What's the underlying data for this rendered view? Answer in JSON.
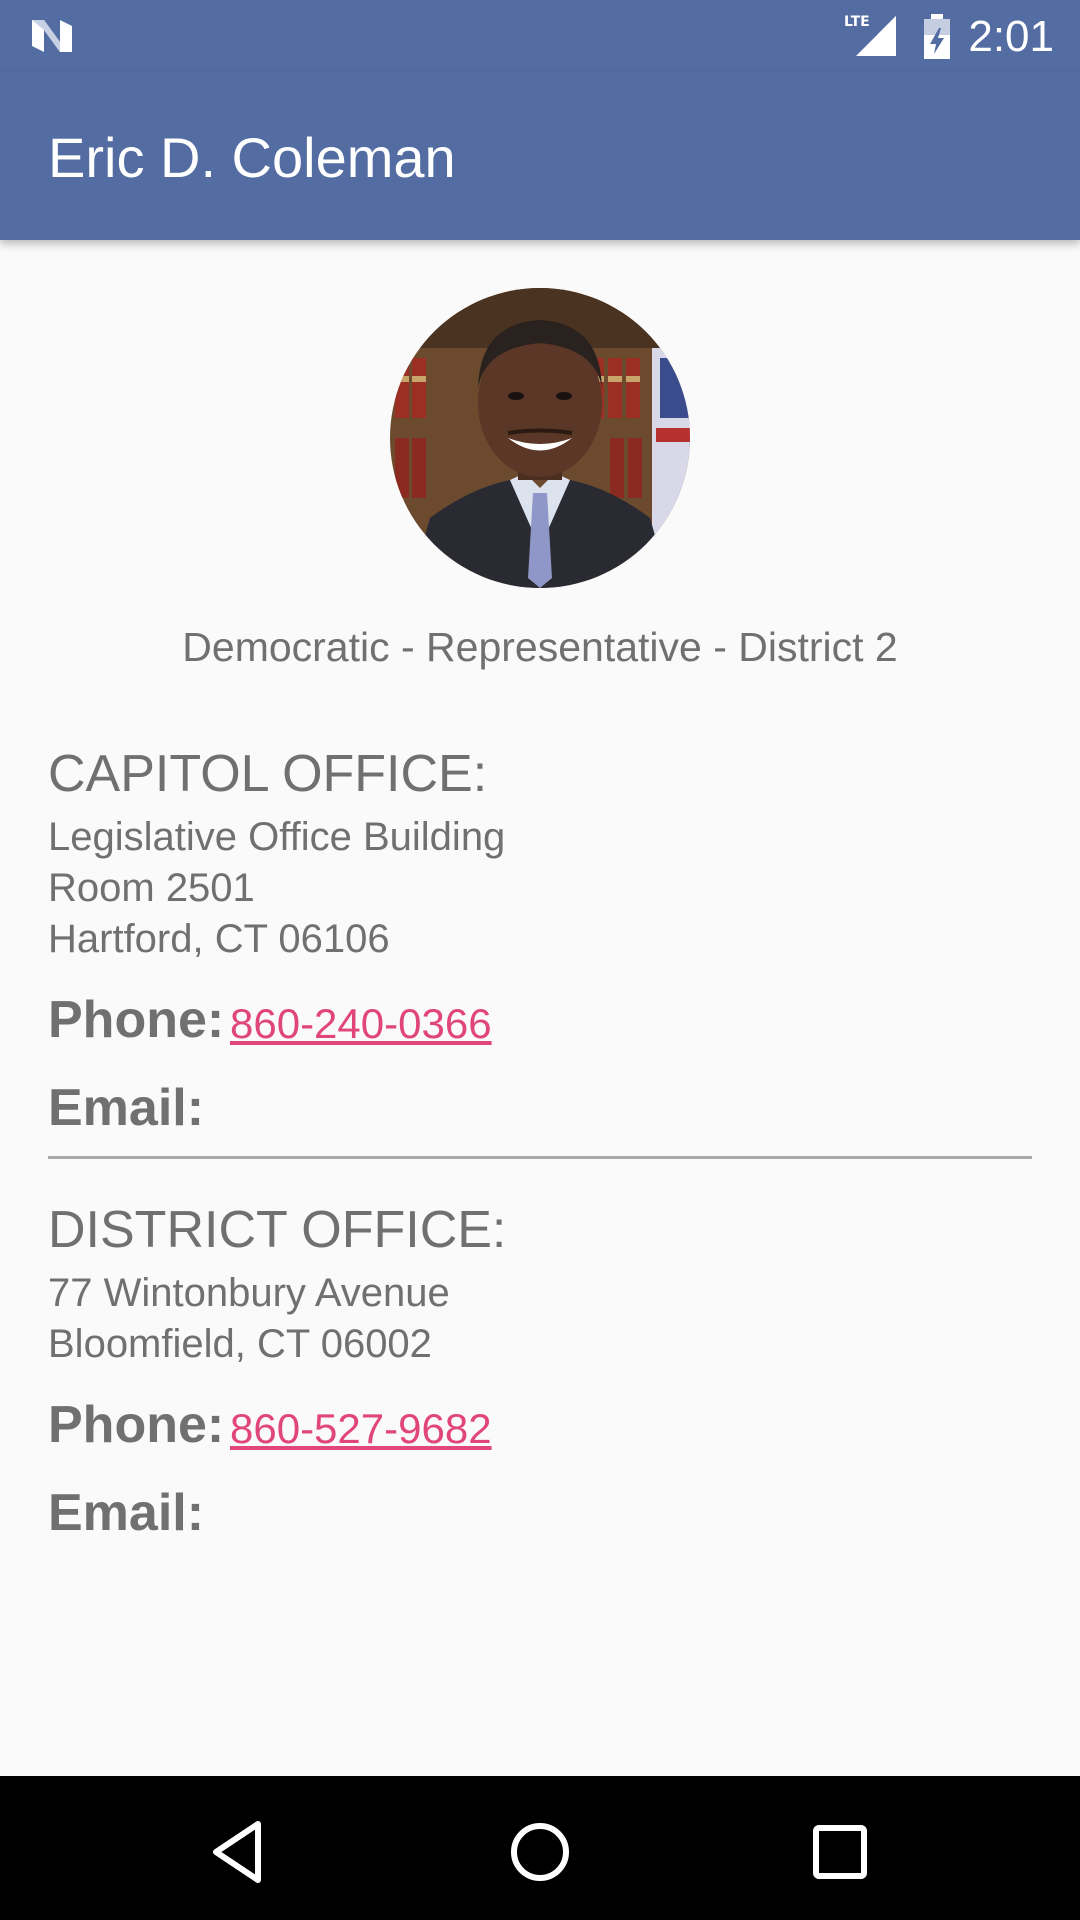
{
  "status_bar": {
    "time": "2:01",
    "network_label": "LTE",
    "icons": [
      "n-notification-icon",
      "lte-signal-icon",
      "battery-charging-icon"
    ]
  },
  "app_bar": {
    "title": "Eric D. Coleman"
  },
  "profile": {
    "subtitle": "Democratic - Representative -  District 2"
  },
  "capitol_office": {
    "heading": "CAPITOL OFFICE:",
    "address": [
      "Legislative Office Building",
      "Room 2501",
      "Hartford, CT 06106"
    ],
    "phone_label": "Phone:",
    "phone": "860-240-0366",
    "email_label": "Email:"
  },
  "district_office": {
    "heading": "DISTRICT OFFICE:",
    "address": [
      "77 Wintonbury Avenue",
      "Bloomfield, CT 06002"
    ],
    "phone_label": "Phone:",
    "phone": "860-527-9682",
    "email_label": "Email:"
  },
  "colors": {
    "app_bar": "#536ca2",
    "text_gray": "#707070",
    "link": "#e0457b",
    "background": "#fafafa"
  },
  "nav_bar": {
    "icons": [
      "back-icon",
      "home-icon",
      "recents-icon"
    ]
  }
}
